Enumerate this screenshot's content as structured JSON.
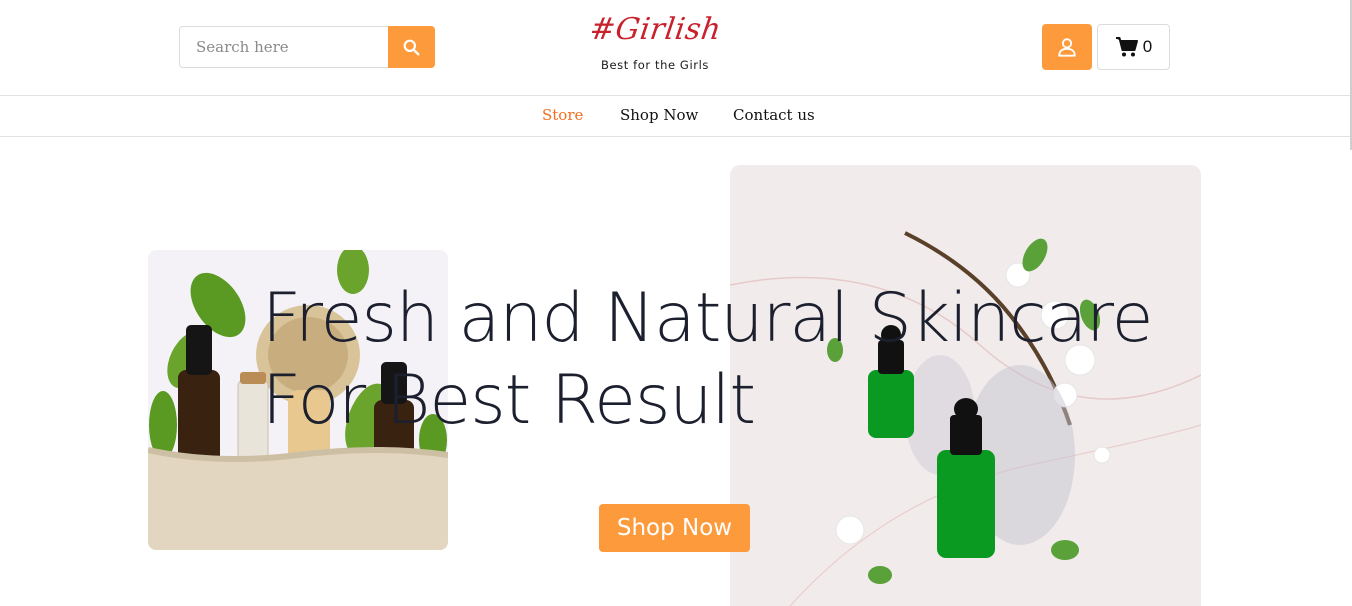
{
  "header": {
    "search": {
      "placeholder": "Search here",
      "value": ""
    },
    "logo": {
      "title": "#Girlish",
      "tagline": "Best for the Girls"
    },
    "cart": {
      "count": "0"
    }
  },
  "nav": {
    "items": [
      {
        "label": "Store",
        "active": true
      },
      {
        "label": "Shop Now",
        "active": false
      },
      {
        "label": "Contact us",
        "active": false
      }
    ]
  },
  "hero": {
    "title_line1": "Fresh and Natural Skincare",
    "title_line2": "For Best Result",
    "button_label": "Shop Now"
  },
  "colors": {
    "accent": "#fd9a3c",
    "nav_active": "#f26f1f",
    "logo": "#c8202c",
    "text": "#1b1f2e"
  },
  "icons": [
    "search-icon",
    "user-icon",
    "cart-icon"
  ]
}
